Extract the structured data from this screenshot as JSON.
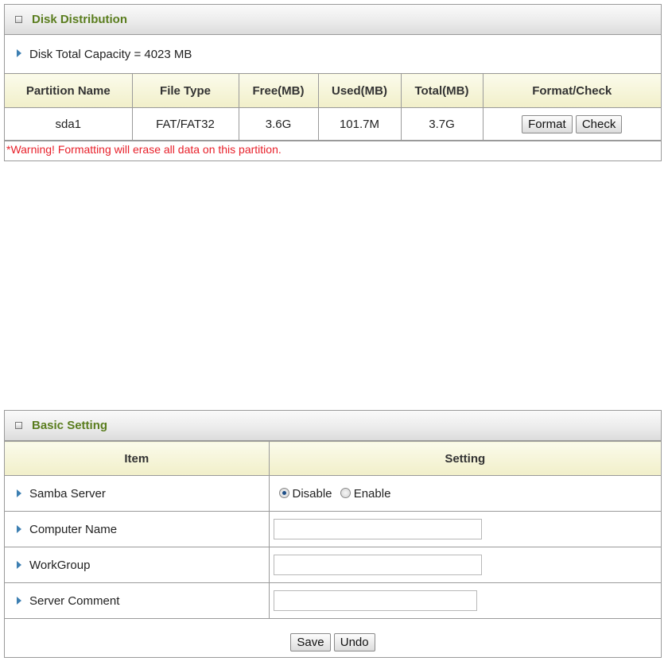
{
  "disk": {
    "title": "Disk Distribution",
    "capacity": "Disk Total Capacity = 4023 MB",
    "columns": [
      "Partition Name",
      "File Type",
      "Free(MB)",
      "Used(MB)",
      "Total(MB)",
      "Format/Check"
    ],
    "row": {
      "name": "sda1",
      "type": "FAT/FAT32",
      "free": "3.6G",
      "used": "101.7M",
      "total": "3.7G"
    },
    "format_label": "Format",
    "check_label": "Check",
    "warning": "*Warning! Formatting will erase all data on this partition."
  },
  "basic": {
    "title": "Basic Setting",
    "col_item": "Item",
    "col_setting": "Setting",
    "samba_label": "Samba Server",
    "samba_options": [
      "Disable",
      "Enable"
    ],
    "samba_selected": "Disable",
    "computer_name_label": "Computer Name",
    "computer_name_value": "",
    "workgroup_label": "WorkGroup",
    "workgroup_value": "",
    "server_comment_label": "Server Comment",
    "server_comment_value": "",
    "save_label": "Save",
    "undo_label": "Undo"
  },
  "colors": {
    "title": "#5a7d1e",
    "warning": "#e8202a",
    "bullet": "#3d7fb2"
  }
}
